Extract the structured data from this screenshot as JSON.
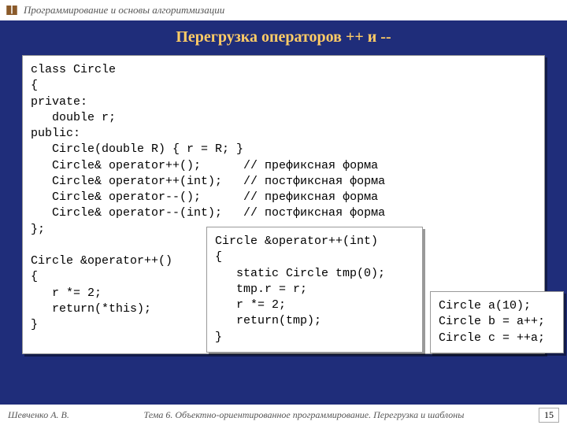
{
  "header": {
    "course": "Программирование и основы алгоритмизации"
  },
  "title": "Перегрузка операторов ++ и --",
  "code": {
    "main": "class Circle\n{\nprivate:\n   double r;\npublic:\n   Circle(double R) { r = R; }\n   Circle& operator++();      // префиксная форма\n   Circle& operator++(int);   // постфиксная форма\n   Circle& operator--();      // префиксная форма\n   Circle& operator--(int);   // постфиксная форма\n};\n\nCircle &operator++()\n{\n   r *= 2;\n   return(*this);\n}",
    "mid": "Circle &operator++(int)\n{\n   static Circle tmp(0);\n   tmp.r = r;\n   r *= 2;\n   return(tmp);\n}",
    "right": "Circle a(10);\nCircle b = a++;\nCircle c = ++a;"
  },
  "footer": {
    "author": "Шевченко А. В.",
    "topic": "Тема 6. Объектно-ориентированное программирование. Перегрузка и шаблоны",
    "page": "15"
  }
}
